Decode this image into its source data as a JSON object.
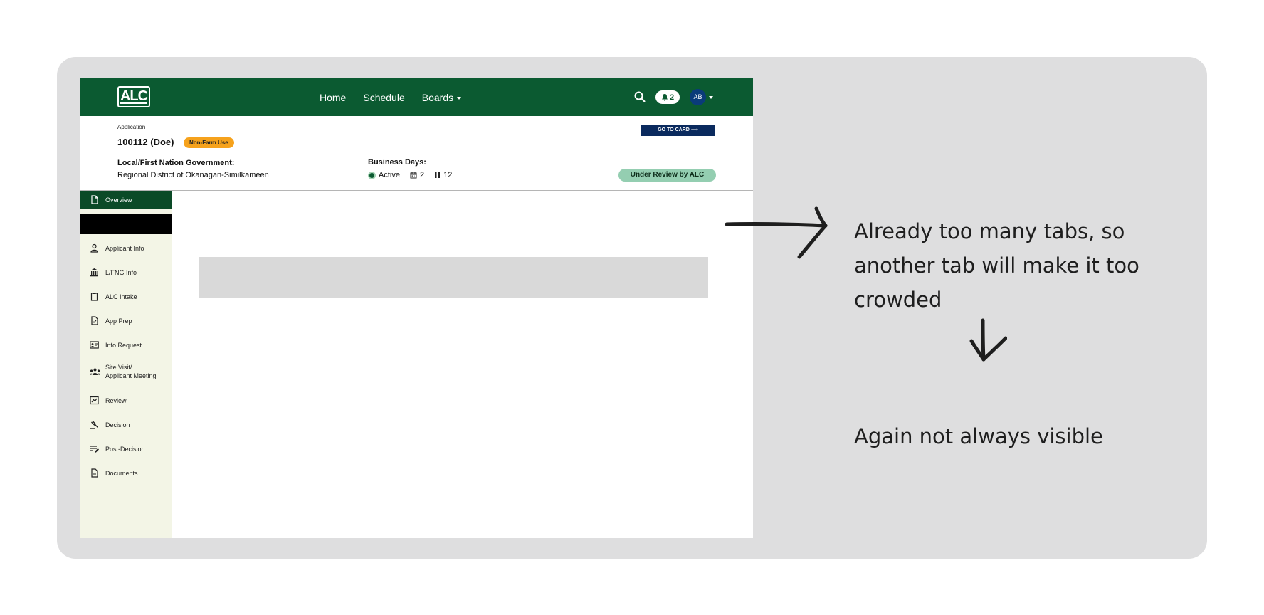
{
  "nav": {
    "logo": "ALC",
    "links": [
      "Home",
      "Schedule",
      "Boards"
    ],
    "notifications": "2",
    "avatar": "AB"
  },
  "header": {
    "label": "Application",
    "id": "100112 (Doe)",
    "type_badge": "Non-Farm Use",
    "goto": "GO TO CARD ⟶",
    "lfng_label": "Local/First Nation Government:",
    "lfng_value": "Regional District of Okanagan-Similkameen",
    "bd_label": "Business Days:",
    "bd_status": "Active",
    "bd_calendar": "2",
    "bd_paused": "12",
    "status": "Under Review by ALC"
  },
  "sidebar": {
    "items": [
      {
        "label": "Overview",
        "icon": "document-icon"
      },
      {
        "label": "Applicant Info",
        "icon": "person-icon"
      },
      {
        "label": "L/FNG Info",
        "icon": "government-icon"
      },
      {
        "label": "ALC Intake",
        "icon": "clipboard-icon"
      },
      {
        "label": "App Prep",
        "icon": "file-check-icon"
      },
      {
        "label": "Info Request",
        "icon": "id-card-icon"
      },
      {
        "label": "Site Visit/",
        "label2": "Applicant Meeting",
        "icon": "group-icon"
      },
      {
        "label": "Review",
        "icon": "review-icon"
      },
      {
        "label": "Decision",
        "icon": "gavel-icon"
      },
      {
        "label": "Post-Decision",
        "icon": "edit-list-icon"
      },
      {
        "label": "Documents",
        "icon": "documents-icon"
      }
    ]
  },
  "annotations": {
    "note1_line1": "Already too many tabs, so",
    "note1_line2": "another tab will make it too",
    "note1_line3": "crowded",
    "note2": "Again not always visible"
  }
}
